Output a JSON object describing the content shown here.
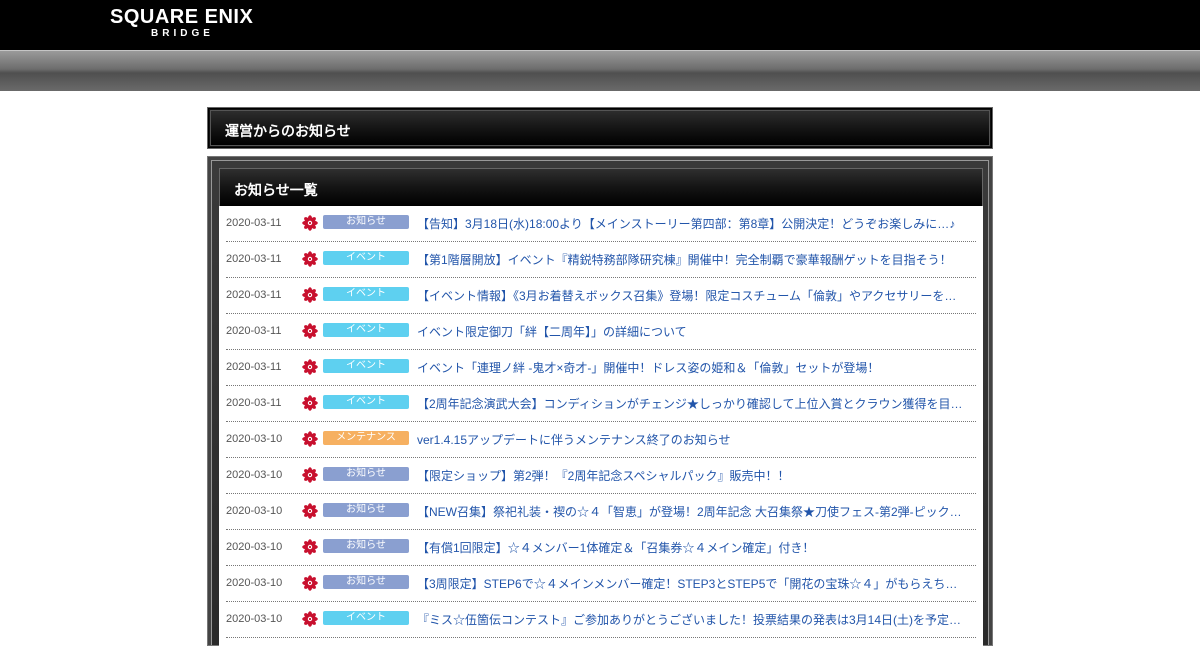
{
  "header": {
    "logo_main": "SQUARE ENIX",
    "logo_sub": "BRIDGE"
  },
  "page_title": "運営からのお知らせ",
  "list_title": "お知らせ一覧",
  "badge_colors": {
    "お知らせ": "#8a9fd0",
    "イベント": "#5ed0f0",
    "メンテナンス": "#f6b061"
  },
  "news": [
    {
      "date": "2020-03-11",
      "category": "お知らせ",
      "title": "【告知】3月18日(水)18:00より【メインストーリー第四部：第8章】公開決定！どうぞお楽しみに…♪"
    },
    {
      "date": "2020-03-11",
      "category": "イベント",
      "title": "【第1階層開放】イベント『精鋭特務部隊研究棟』開催中！完全制覇で豪華報酬ゲットを目指そう！"
    },
    {
      "date": "2020-03-11",
      "category": "イベント",
      "title": "【イベント情報】《3月お着替えボックス召集》登場！限定コスチューム「倫敦」やアクセサリーを…"
    },
    {
      "date": "2020-03-11",
      "category": "イベント",
      "title": "イベント限定御刀「絆【二周年】」の詳細について"
    },
    {
      "date": "2020-03-11",
      "category": "イベント",
      "title": "イベント「連理ノ絆 -鬼才×奇才-」開催中！ドレス姿の姫和＆「倫敦」セットが登場！"
    },
    {
      "date": "2020-03-11",
      "category": "イベント",
      "title": "【2周年記念演武大会】コンディションがチェンジ★しっかり確認して上位入賞とクラウン獲得を目…"
    },
    {
      "date": "2020-03-10",
      "category": "メンテナンス",
      "title": "ver1.4.15アップデートに伴うメンテナンス終了のお知らせ"
    },
    {
      "date": "2020-03-10",
      "category": "お知らせ",
      "title": "【限定ショップ】第2弾！『2周年記念スペシャルパック』販売中！！"
    },
    {
      "date": "2020-03-10",
      "category": "お知らせ",
      "title": "【NEW召集】祭祀礼装・禊の☆４「智恵」が登場！2周年記念 大召集祭★刀使フェス-第2弾-ピック…"
    },
    {
      "date": "2020-03-10",
      "category": "お知らせ",
      "title": "【有償1回限定】☆４メンバー1体確定＆「召集券☆４メイン確定」付き！"
    },
    {
      "date": "2020-03-10",
      "category": "お知らせ",
      "title": "【3周限定】STEP6で☆４メインメンバー確定！STEP3とSTEP5で「開花の宝珠☆４」がもらえち…"
    },
    {
      "date": "2020-03-10",
      "category": "イベント",
      "title": "『ミス☆伍箇伝コンテスト』ご参加ありがとうございました！投票結果の発表は3月14日(土)を予定…"
    }
  ]
}
